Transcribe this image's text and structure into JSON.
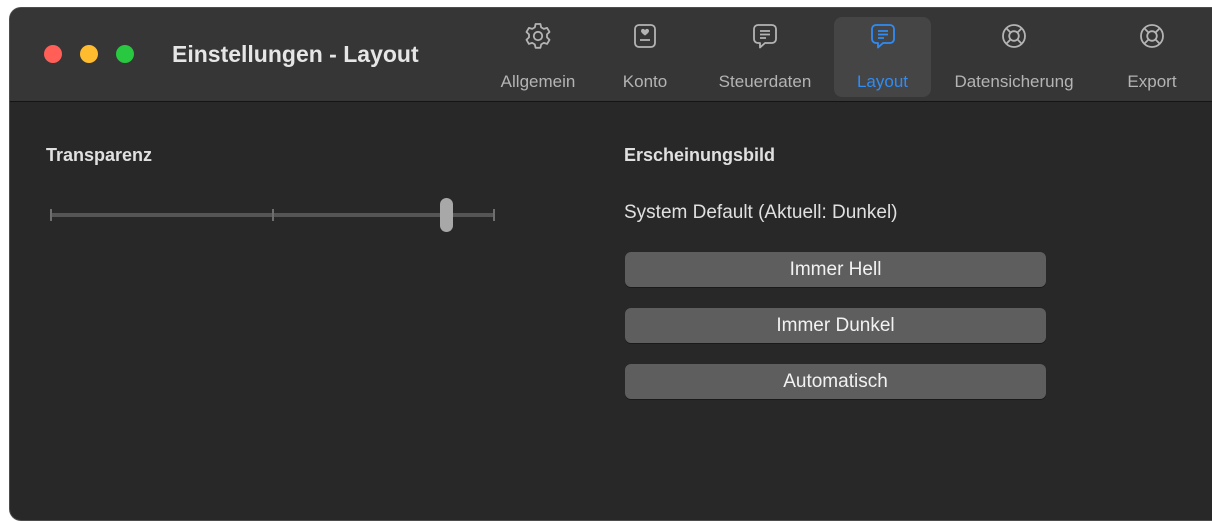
{
  "window": {
    "title": "Einstellungen - Layout"
  },
  "tabs": [
    {
      "label": "Allgemein",
      "icon": "gear-icon",
      "active": false
    },
    {
      "label": "Konto",
      "icon": "id-card-icon",
      "active": false
    },
    {
      "label": "Steuerdaten",
      "icon": "speech-bubble-icon",
      "active": false
    },
    {
      "label": "Layout",
      "icon": "speech-bubble-icon",
      "active": true
    },
    {
      "label": "Datensicherung",
      "icon": "lifebuoy-icon",
      "active": false
    },
    {
      "label": "Export",
      "icon": "lifebuoy-icon",
      "active": false
    }
  ],
  "transparency": {
    "title": "Transparenz",
    "value_fraction": 0.89
  },
  "appearance": {
    "title": "Erscheinungsbild",
    "current": "System Default (Aktuell: Dunkel)",
    "buttons": [
      "Immer Hell",
      "Immer Dunkel",
      "Automatisch"
    ]
  },
  "colors": {
    "accent": "#2f8cf5",
    "window_bg": "#282828",
    "toolbar_bg": "#363636",
    "button_bg": "#5e5e5e"
  }
}
